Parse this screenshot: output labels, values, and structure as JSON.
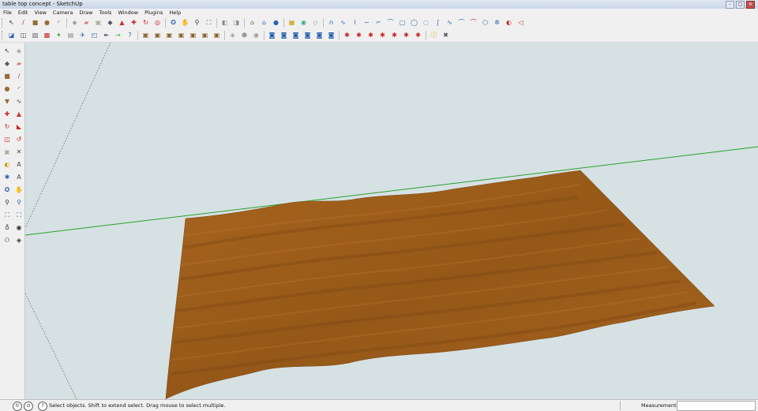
{
  "window": {
    "title": "table top concept - SketchUp"
  },
  "window_controls": {
    "minimize": "–",
    "maximize": "□",
    "close": "✕"
  },
  "menu": [
    "File",
    "Edit",
    "View",
    "Camera",
    "Draw",
    "Tools",
    "Window",
    "Plugins",
    "Help"
  ],
  "toolbar_row1": [
    {
      "name": "select",
      "glyph": "↖",
      "color": "#333"
    },
    {
      "name": "line",
      "glyph": "/",
      "color": "#b33"
    },
    {
      "name": "rectangle",
      "glyph": "■",
      "color": "#9a6a3a"
    },
    {
      "name": "circle",
      "glyph": "●",
      "color": "#9a6a3a"
    },
    {
      "name": "arc",
      "glyph": "◜",
      "color": "#555"
    },
    {
      "name": "sep"
    },
    {
      "name": "make-component",
      "glyph": "◈",
      "color": "#888"
    },
    {
      "name": "eraser",
      "glyph": "▰",
      "color": "#d77"
    },
    {
      "name": "tape-measure",
      "glyph": "▣",
      "color": "#aa9"
    },
    {
      "name": "paint-bucket",
      "glyph": "◆",
      "color": "#556"
    },
    {
      "name": "push-pull",
      "glyph": "▲",
      "color": "#c33"
    },
    {
      "name": "move",
      "glyph": "✚",
      "color": "#c22"
    },
    {
      "name": "rotate",
      "glyph": "↻",
      "color": "#c22"
    },
    {
      "name": "offset",
      "glyph": "◎",
      "color": "#c22"
    },
    {
      "name": "sep"
    },
    {
      "name": "orbit",
      "glyph": "✪",
      "color": "#2a62b0"
    },
    {
      "name": "pan",
      "glyph": "✋",
      "color": "#444"
    },
    {
      "name": "zoom",
      "glyph": "⚲",
      "color": "#333"
    },
    {
      "name": "zoom-extents",
      "glyph": "⛶",
      "color": "#2a62b0"
    },
    {
      "name": "sep"
    },
    {
      "name": "previous-view",
      "glyph": "◧",
      "color": "#888"
    },
    {
      "name": "next-view",
      "glyph": "◨",
      "color": "#888"
    },
    {
      "name": "sep"
    },
    {
      "name": "get-models",
      "glyph": "⌂",
      "color": "#7a5c2a"
    },
    {
      "name": "share-model",
      "glyph": "⌂",
      "color": "#2a62b0"
    },
    {
      "name": "share-component",
      "glyph": "●",
      "color": "#2a62b0"
    },
    {
      "name": "sep"
    },
    {
      "name": "photo-textures",
      "glyph": "▦",
      "color": "#c90"
    },
    {
      "name": "preview-google-earth",
      "glyph": "◉",
      "color": "#3a8"
    },
    {
      "name": "toggle-terrain",
      "glyph": "◇",
      "color": "#999"
    },
    {
      "name": "sep"
    },
    {
      "name": "bezier",
      "glyph": "∩",
      "color": "#2a62b0"
    },
    {
      "name": "freehand",
      "glyph": "∿",
      "color": "#2a62b0"
    },
    {
      "name": "polyline",
      "glyph": "⌇",
      "color": "#2a62b0"
    },
    {
      "name": "spline",
      "glyph": "∽",
      "color": "#2a62b0"
    },
    {
      "name": "catmull",
      "glyph": "⌐",
      "color": "#2a62b0"
    },
    {
      "name": "arc-3pt",
      "glyph": "⌒",
      "color": "#2a62b0"
    },
    {
      "name": "rounded-rect",
      "glyph": "▢",
      "color": "#2a62b0"
    },
    {
      "name": "ellipse",
      "glyph": "◯",
      "color": "#2a62b0"
    },
    {
      "name": "cubic",
      "glyph": "◌",
      "color": "#2a62b0"
    },
    {
      "name": "divider",
      "glyph": "∫",
      "color": "#2a62b0"
    },
    {
      "name": "fspline",
      "glyph": "∿",
      "color": "#2a62b0"
    },
    {
      "name": "arc-curve",
      "glyph": "⌒",
      "color": "#2a62b0"
    },
    {
      "name": "uniform",
      "glyph": "⌒",
      "color": "#c22"
    },
    {
      "name": "polygon",
      "glyph": "⬡",
      "color": "#2a62b0"
    },
    {
      "name": "star",
      "glyph": "✲",
      "color": "#2a62b0"
    },
    {
      "name": "shape",
      "glyph": "◐",
      "color": "#c22"
    },
    {
      "name": "freeform",
      "glyph": "◁",
      "color": "#c22"
    }
  ],
  "toolbar_row2": [
    {
      "name": "face-style",
      "glyph": "◪",
      "color": "#2a62b0"
    },
    {
      "name": "camera-std",
      "glyph": "◫",
      "color": "#444"
    },
    {
      "name": "xray",
      "glyph": "▧",
      "color": "#666"
    },
    {
      "name": "back-edges",
      "glyph": "▩",
      "color": "#c22"
    },
    {
      "name": "intersect",
      "glyph": "✦",
      "color": "#3a3"
    },
    {
      "name": "hidden",
      "glyph": "▤",
      "color": "#888"
    },
    {
      "name": "solid-tools",
      "glyph": "✈",
      "color": "#2a62b0"
    },
    {
      "name": "sandbox",
      "glyph": "◰",
      "color": "#2a62b0"
    },
    {
      "name": "dimension",
      "glyph": "↞",
      "color": "#444"
    },
    {
      "name": "section",
      "glyph": "→",
      "color": "#2b2"
    },
    {
      "name": "help",
      "glyph": "?",
      "color": "#2a62b0"
    },
    {
      "name": "sep"
    },
    {
      "name": "box-1",
      "glyph": "▣",
      "color": "#8a5c2a"
    },
    {
      "name": "box-2",
      "glyph": "▣",
      "color": "#8a5c2a"
    },
    {
      "name": "box-3",
      "glyph": "▣",
      "color": "#8a5c2a"
    },
    {
      "name": "box-4",
      "glyph": "▣",
      "color": "#8a5c2a"
    },
    {
      "name": "box-5",
      "glyph": "▣",
      "color": "#8a5c2a"
    },
    {
      "name": "box-6",
      "glyph": "▣",
      "color": "#8a5c2a"
    },
    {
      "name": "box-7",
      "glyph": "▣",
      "color": "#8a5c2a"
    },
    {
      "name": "sep"
    },
    {
      "name": "style-1",
      "glyph": "◈",
      "color": "#999"
    },
    {
      "name": "style-2",
      "glyph": "⬢",
      "color": "#999"
    },
    {
      "name": "style-3",
      "glyph": "◉",
      "color": "#999"
    },
    {
      "name": "sep"
    },
    {
      "name": "view-iso",
      "glyph": "◙",
      "color": "#2a62b0"
    },
    {
      "name": "view-top",
      "glyph": "◙",
      "color": "#2a62b0"
    },
    {
      "name": "view-front",
      "glyph": "◙",
      "color": "#2a62b0"
    },
    {
      "name": "view-right",
      "glyph": "◙",
      "color": "#2a62b0"
    },
    {
      "name": "view-back",
      "glyph": "◙",
      "color": "#2a62b0"
    },
    {
      "name": "view-left",
      "glyph": "◙",
      "color": "#2a62b0"
    },
    {
      "name": "sep"
    },
    {
      "name": "walk-1",
      "glyph": "✱",
      "color": "#c22"
    },
    {
      "name": "walk-2",
      "glyph": "✱",
      "color": "#c22"
    },
    {
      "name": "walk-3",
      "glyph": "✱",
      "color": "#c22"
    },
    {
      "name": "walk-4",
      "glyph": "✱",
      "color": "#c22"
    },
    {
      "name": "walk-5",
      "glyph": "✱",
      "color": "#c22"
    },
    {
      "name": "walk-6",
      "glyph": "✱",
      "color": "#c22"
    },
    {
      "name": "walk-7",
      "glyph": "✱",
      "color": "#c22"
    },
    {
      "name": "sep"
    },
    {
      "name": "info",
      "glyph": "ⓘ",
      "color": "#c90"
    },
    {
      "name": "tools",
      "glyph": "✖",
      "color": "#555"
    }
  ],
  "left_toolbar": [
    {
      "name": "select",
      "glyph": "↖",
      "color": "#333"
    },
    {
      "name": "make-component",
      "glyph": "◈",
      "color": "#999"
    },
    {
      "name": "paint-bucket",
      "glyph": "◆",
      "color": "#556"
    },
    {
      "name": "eraser",
      "glyph": "▰",
      "color": "#d77"
    },
    {
      "name": "rectangle",
      "glyph": "■",
      "color": "#9a6a3a"
    },
    {
      "name": "line",
      "glyph": "/",
      "color": "#b33"
    },
    {
      "name": "circle",
      "glyph": "●",
      "color": "#9a6a3a"
    },
    {
      "name": "arc",
      "glyph": "◜",
      "color": "#555"
    },
    {
      "name": "polygon",
      "glyph": "▼",
      "color": "#9a6a3a"
    },
    {
      "name": "freehand",
      "glyph": "∿",
      "color": "#444"
    },
    {
      "name": "move",
      "glyph": "✚",
      "color": "#c22"
    },
    {
      "name": "push-pull",
      "glyph": "▲",
      "color": "#c33"
    },
    {
      "name": "rotate",
      "glyph": "↻",
      "color": "#c22"
    },
    {
      "name": "follow-me",
      "glyph": "◣",
      "color": "#c22"
    },
    {
      "name": "scale",
      "glyph": "◫",
      "color": "#c22"
    },
    {
      "name": "offset",
      "glyph": "↺",
      "color": "#c22"
    },
    {
      "name": "tape-measure",
      "glyph": "▣",
      "color": "#aa9"
    },
    {
      "name": "dimension",
      "glyph": "✕",
      "color": "#444"
    },
    {
      "name": "protractor",
      "glyph": "◐",
      "color": "#c90"
    },
    {
      "name": "text",
      "glyph": "A",
      "color": "#444"
    },
    {
      "name": "axes",
      "glyph": "✱",
      "color": "#2a62b0"
    },
    {
      "name": "3d-text",
      "glyph": "A",
      "color": "#444"
    },
    {
      "name": "orbit",
      "glyph": "✪",
      "color": "#2a62b0"
    },
    {
      "name": "pan",
      "glyph": "✋",
      "color": "#444"
    },
    {
      "name": "zoom",
      "glyph": "⚲",
      "color": "#333"
    },
    {
      "name": "zoom-window",
      "glyph": "⚲",
      "color": "#2a62b0"
    },
    {
      "name": "zoom-extents",
      "glyph": "⛶",
      "color": "#2a62b0"
    },
    {
      "name": "previous",
      "glyph": "⛶",
      "color": "#2a62b0"
    },
    {
      "name": "position-camera",
      "glyph": "♁",
      "color": "#333"
    },
    {
      "name": "look-around",
      "glyph": "◉",
      "color": "#333"
    },
    {
      "name": "walk",
      "glyph": "⚇",
      "color": "#333"
    },
    {
      "name": "section-plane",
      "glyph": "◈",
      "color": "#333"
    }
  ],
  "status": {
    "text": "Select objects. Shift to extend select. Drag mouse to select multiple.",
    "icons": [
      "?",
      "©",
      "⊙"
    ],
    "measurements_label": "Measurements",
    "measurements_value": ""
  },
  "colors": {
    "viewport_bg": "#d6e1e4",
    "surface": "#9a5a1a",
    "axis_green": "#2aa02a",
    "axis_dotted": "#555555"
  }
}
